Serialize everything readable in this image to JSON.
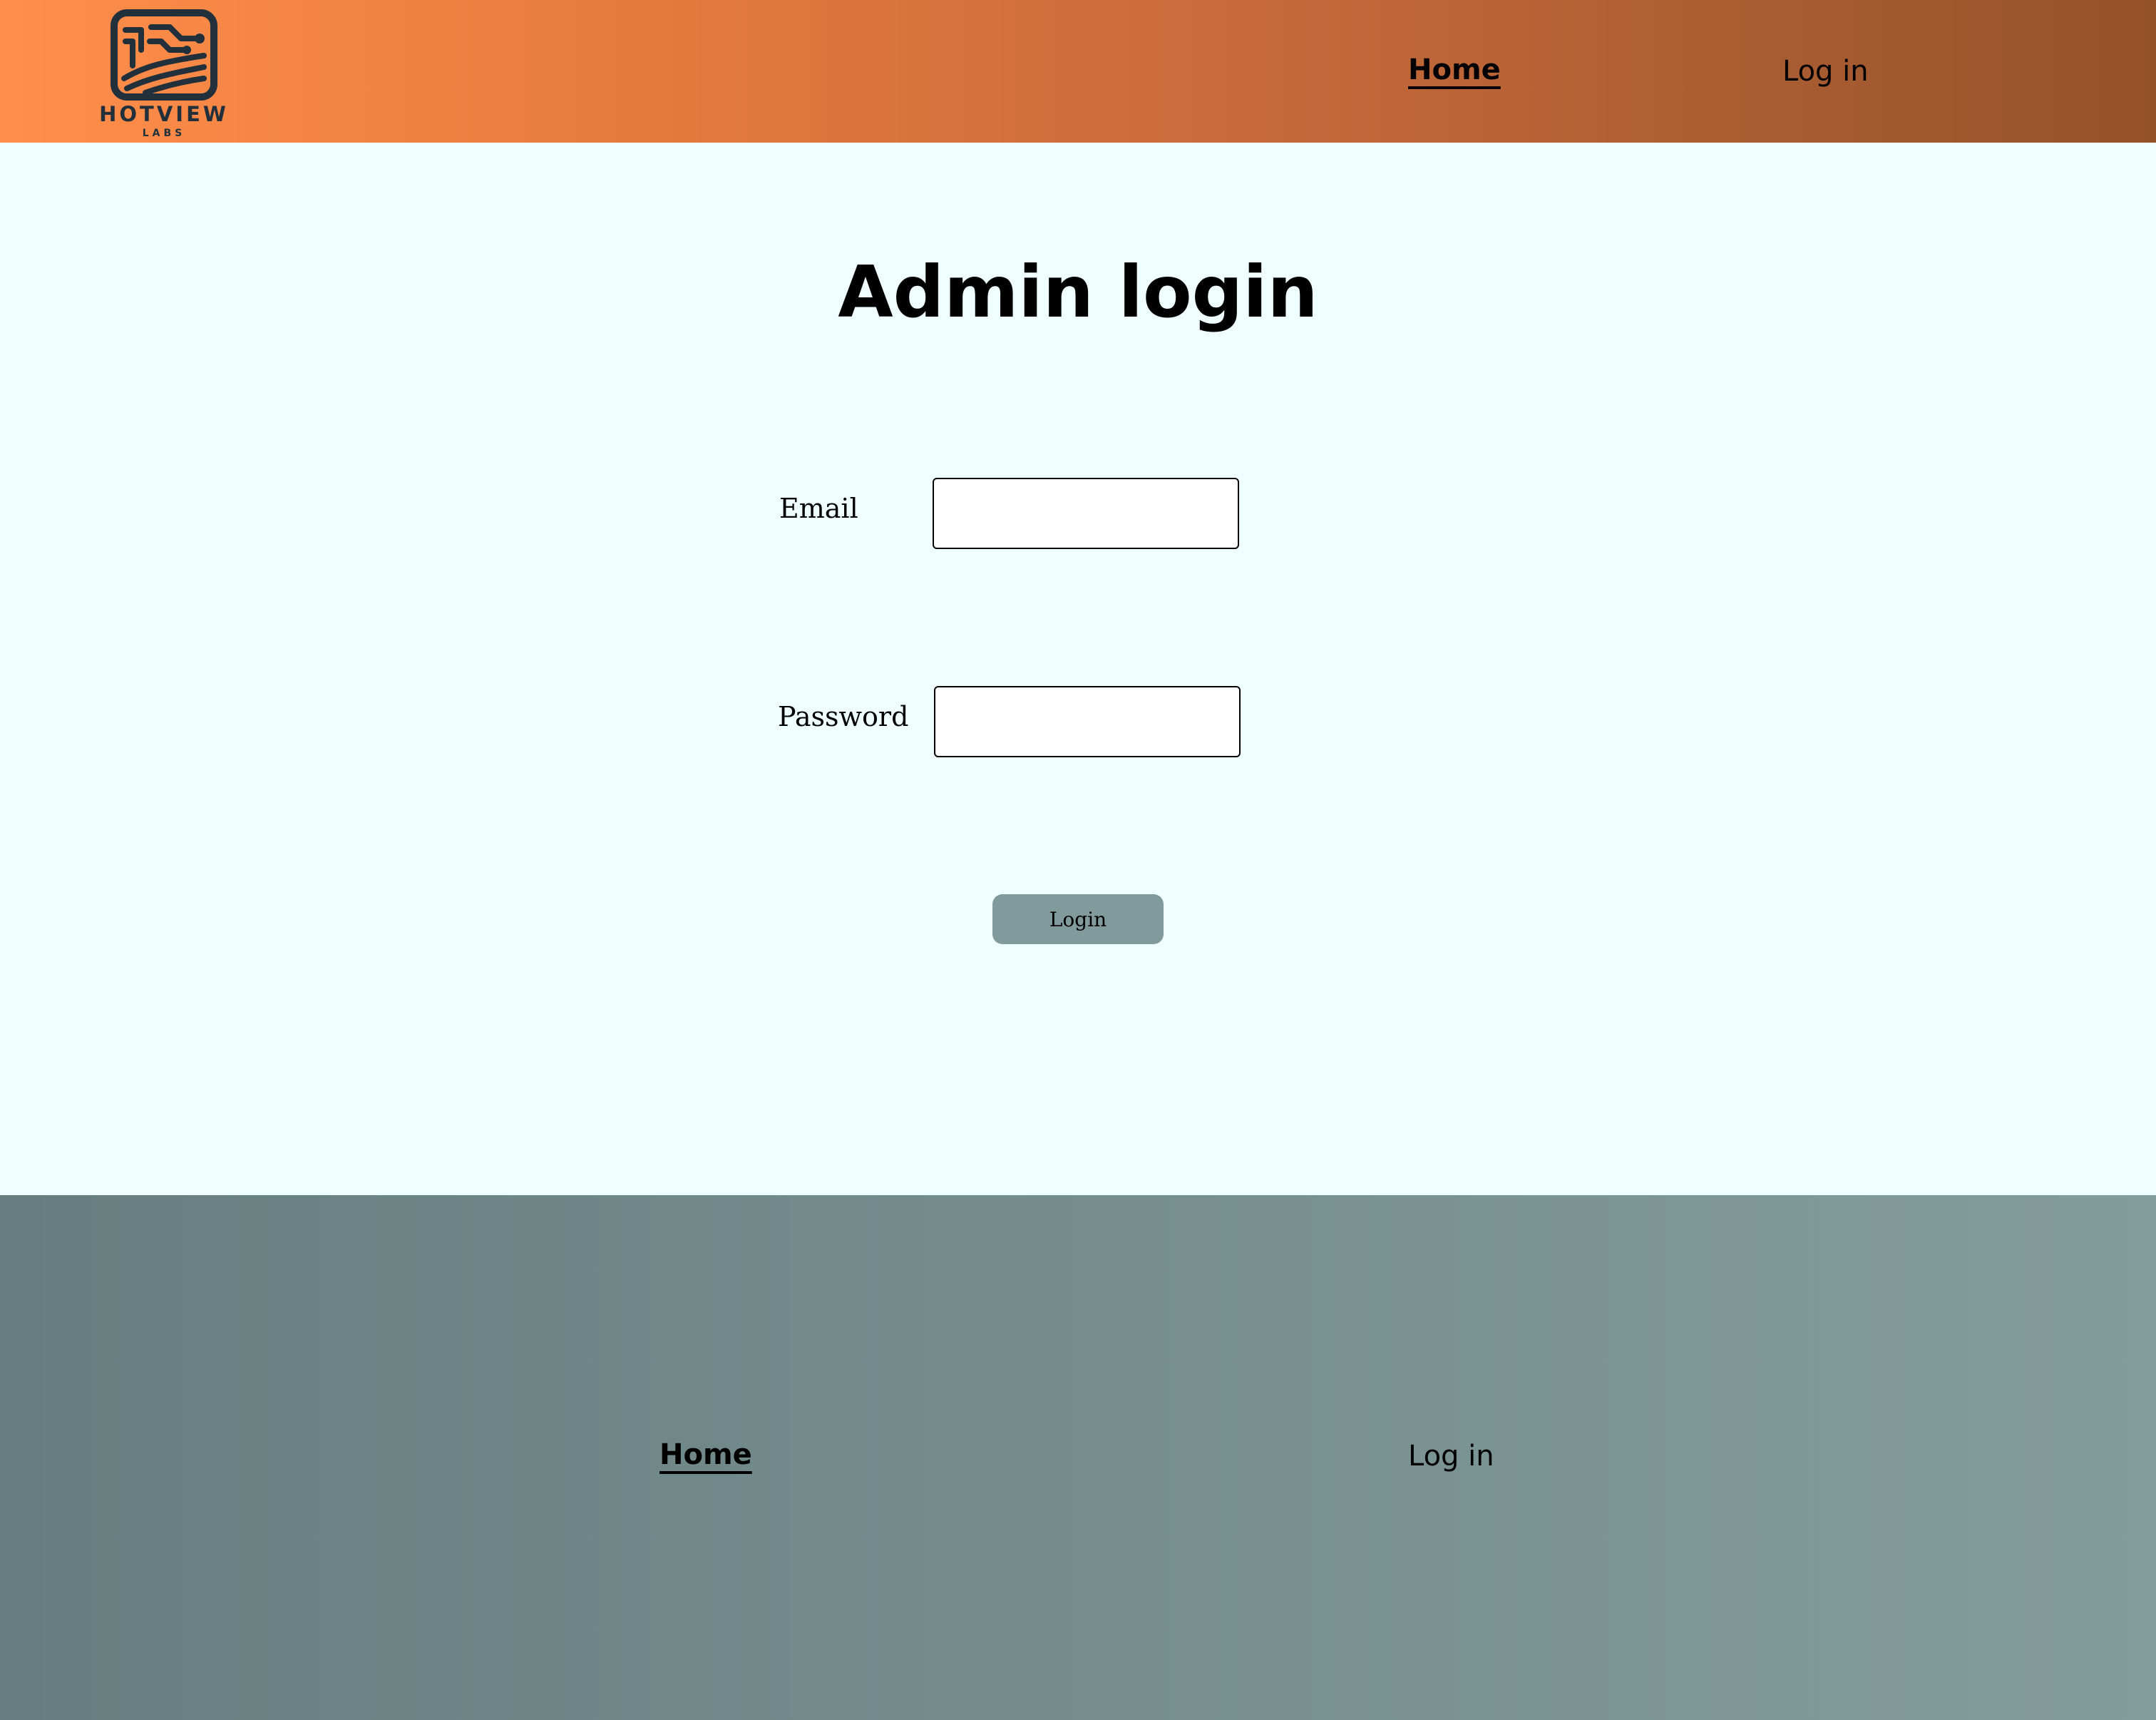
{
  "header": {
    "logo": {
      "name": "HOTVIEW",
      "sub": "LABS",
      "icon": "circuit-board-icon"
    },
    "nav": [
      {
        "label": "Home",
        "active": true
      },
      {
        "label": "Log in",
        "active": false
      }
    ]
  },
  "main": {
    "title": "Admin login",
    "email_label": "Email",
    "email_value": "",
    "password_label": "Password",
    "password_value": "",
    "login_button_label": "Login"
  },
  "footer": {
    "nav": [
      {
        "label": "Home",
        "active": true
      },
      {
        "label": "Log in",
        "active": false
      }
    ]
  },
  "colors": {
    "header_gradient_start": "#ff8e4a",
    "header_gradient_end": "#94522b",
    "page_background": "#efffff",
    "footer_gradient_start": "#667e7f",
    "footer_gradient_end": "#839c9c",
    "button_background": "#819a9b",
    "logo_dark": "#22303c"
  }
}
